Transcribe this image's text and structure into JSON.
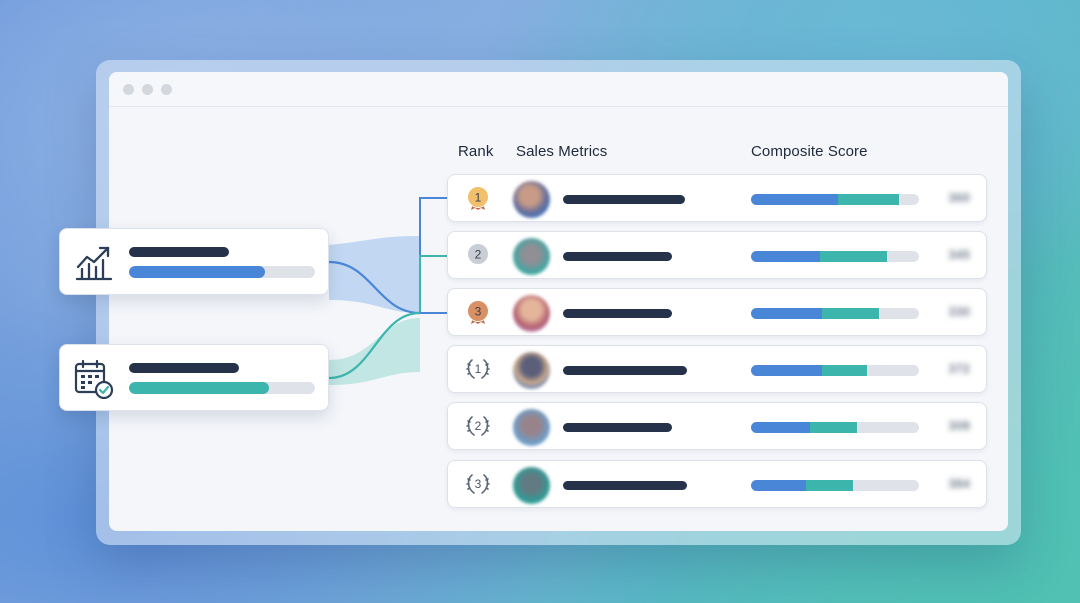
{
  "headers": {
    "rank": "Rank",
    "sales_metrics": "Sales Metrics",
    "composite_score": "Composite Score"
  },
  "metric_cards": [
    {
      "icon": "trending-chart-icon",
      "fill_fraction": 0.73,
      "color": "#4a86d8"
    },
    {
      "icon": "calendar-check-icon",
      "fill_fraction": 0.75,
      "color": "#3cb5ad"
    }
  ],
  "rows": [
    {
      "rank": "1",
      "medal": "gold-medal-icon",
      "medal_color": "#f2c06a",
      "score": "360",
      "score_fraction": 0.88,
      "blue_fraction": 0.52
    },
    {
      "rank": "2",
      "medal": "silver-medal-icon",
      "medal_color": "#c9ced6",
      "score": "345",
      "score_fraction": 0.81,
      "blue_fraction": 0.41
    },
    {
      "rank": "3",
      "medal": "bronze-medal-icon",
      "medal_color": "#d89064",
      "score": "330",
      "score_fraction": 0.76,
      "blue_fraction": 0.42
    },
    {
      "rank": "1",
      "medal": "laurel-icon",
      "medal_color": "#5a6576",
      "score": "372",
      "score_fraction": 0.69,
      "blue_fraction": 0.42
    },
    {
      "rank": "2",
      "medal": "laurel-icon",
      "medal_color": "#5a6576",
      "score": "308",
      "score_fraction": 0.63,
      "blue_fraction": 0.35
    },
    {
      "rank": "3",
      "medal": "laurel-icon",
      "medal_color": "#5a6576",
      "score": "384",
      "score_fraction": 0.61,
      "blue_fraction": 0.33
    }
  ],
  "colors": {
    "accent_blue": "#4a86d8",
    "accent_teal": "#3cb5ad",
    "text_dark": "#1e2a3b"
  }
}
